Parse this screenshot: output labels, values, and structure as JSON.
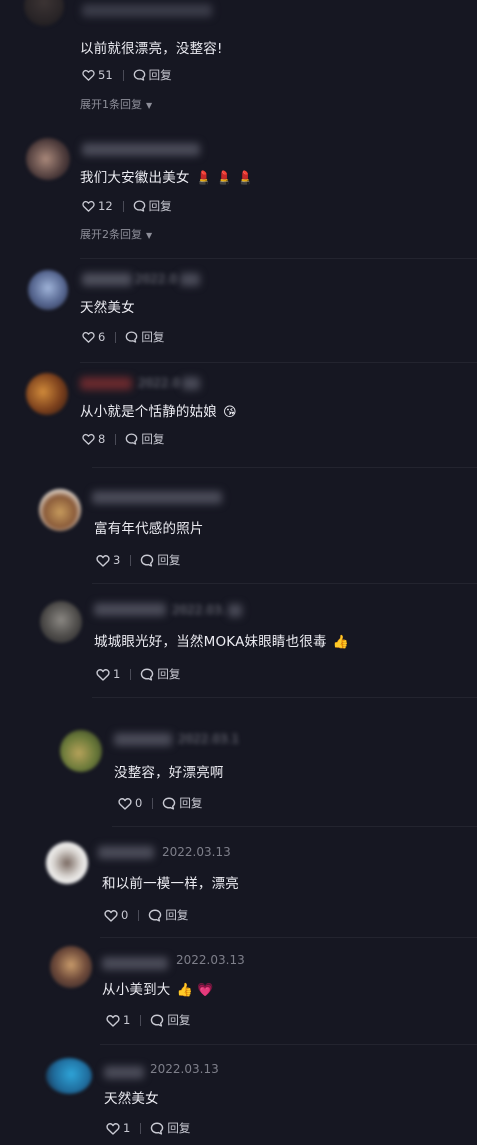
{
  "labels": {
    "reply": "回复"
  },
  "comments": [
    {
      "text": "以前就很漂亮，没整容!",
      "likes": "51",
      "expand": "展开1条回复"
    },
    {
      "text": "我们大安徽出美女",
      "emoji": "💄 💄 💄",
      "likes": "12",
      "expand": "展开2条回复"
    },
    {
      "date": "2022.0",
      "text": "天然美女",
      "likes": "6"
    },
    {
      "date": "2022.0",
      "text": "从小就是个恬静的姑娘",
      "emoji": "😘",
      "likes": "8"
    },
    {
      "text": "富有年代感的照片",
      "likes": "3"
    },
    {
      "date": "2022.03.",
      "text": "城城眼光好，当然MOKA妹眼睛也很毒",
      "emoji": "👍",
      "likes": "1"
    },
    {
      "date": "2022.03.1",
      "text": "没整容，好漂亮啊",
      "likes": "0"
    },
    {
      "date": "2022.03.13",
      "text": "和以前一模一样，漂亮",
      "likes": "0"
    },
    {
      "date": "2022.03.13",
      "text": "从小美到大",
      "emoji": "👍 💗",
      "likes": "1"
    },
    {
      "date": "2022.03.13",
      "text": "天然美女",
      "likes": "1"
    }
  ],
  "colors": {
    "background": "#161722",
    "text": "#ececf2",
    "meta": "#7e7f8a",
    "divider": "#23242f"
  },
  "icons": {
    "like": "heart-outline-icon",
    "reply": "speech-bubble-icon",
    "expand": "chevron-down-icon"
  }
}
